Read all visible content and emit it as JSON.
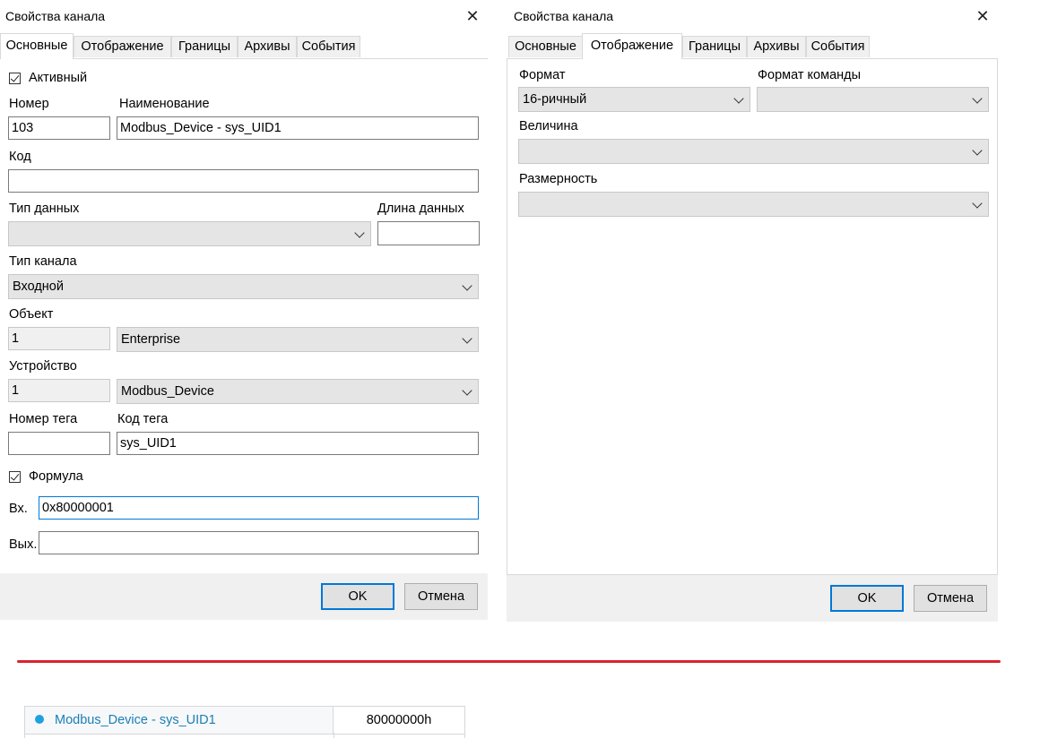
{
  "left_dialog": {
    "title": "Свойства канала",
    "close_glyph": "✕",
    "tabs": [
      "Основные",
      "Отображение",
      "Границы",
      "Архивы",
      "События"
    ],
    "active_tab": "Основные",
    "active_checkbox_label": "Активный",
    "active_checked": true,
    "number_label": "Номер",
    "number_value": "103",
    "name_label": "Наименование",
    "name_value": "Modbus_Device - sys_UID1",
    "code_label": "Код",
    "code_value": "",
    "datatype_label": "Тип данных",
    "datatype_value": "",
    "datalen_label": "Длина данных",
    "datalen_value": "",
    "channeltype_label": "Тип канала",
    "channeltype_value": "Входной",
    "object_label": "Объект",
    "object_num": "1",
    "object_value": "Enterprise",
    "device_label": "Устройство",
    "device_num": "1",
    "device_value": "Modbus_Device",
    "tagnum_label": "Номер тега",
    "tagnum_value": "",
    "tagcode_label": "Код тега",
    "tagcode_value": "sys_UID1",
    "formula_label": "Формула",
    "formula_checked": true,
    "in_label": "Вх.",
    "in_value": "0x80000001",
    "out_label": "Вых.",
    "out_value": "",
    "ok_label": "OK",
    "cancel_label": "Отмена"
  },
  "right_dialog": {
    "title": "Свойства канала",
    "close_glyph": "✕",
    "tabs": [
      "Основные",
      "Отображение",
      "Границы",
      "Архивы",
      "События"
    ],
    "active_tab": "Отображение",
    "format_label": "Формат",
    "format_value": "16-ричный",
    "cmdformat_label": "Формат команды",
    "cmdformat_value": "",
    "quantity_label": "Величина",
    "quantity_value": "",
    "unit_label": "Размерность",
    "unit_value": "",
    "ok_label": "OK",
    "cancel_label": "Отмена"
  },
  "channel_row": {
    "name": "Modbus_Device - sys_UID1",
    "value": "80000000h"
  },
  "colors": {
    "accent": "#0078d7",
    "divider": "#d9232f",
    "status_dot": "#1ea1e0",
    "link_text": "#1a7fb4",
    "footer_bg": "#f0f0f0",
    "combo_bg": "#e5e5e5"
  }
}
